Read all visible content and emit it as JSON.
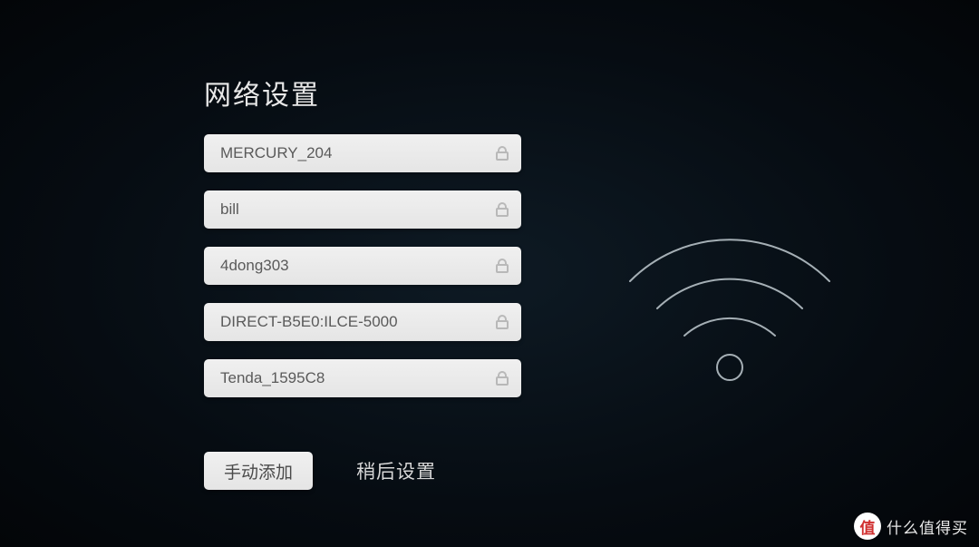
{
  "title": "网络设置",
  "networks": [
    {
      "name": "MERCURY_204",
      "secured": true
    },
    {
      "name": "bill",
      "secured": true
    },
    {
      "name": "4dong303",
      "secured": true
    },
    {
      "name": "DIRECT-B5E0:ILCE-5000",
      "secured": true
    },
    {
      "name": "Tenda_1595C8",
      "secured": true
    }
  ],
  "buttons": {
    "manual_add": "手动添加",
    "later": "稍后设置"
  },
  "watermark": {
    "badge": "值",
    "text": "什么值得买"
  }
}
